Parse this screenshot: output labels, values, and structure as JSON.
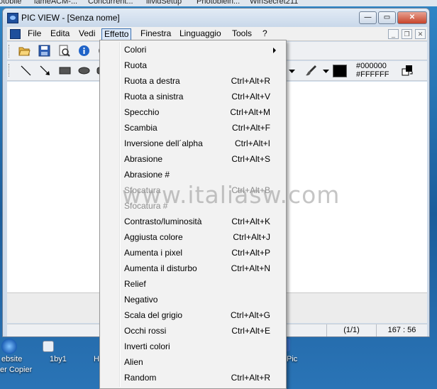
{
  "taskbar": {
    "items": [
      "otobile",
      "lameACM-...",
      "Concurrent...",
      "llivldSetup",
      "Photoblein...",
      "WinSecret211"
    ]
  },
  "desktop": {
    "icons": [
      {
        "label": "ebsite"
      },
      {
        "label": "er Copier"
      },
      {
        "label": "1by1"
      },
      {
        "label": "H"
      },
      {
        "label": "Pic"
      }
    ]
  },
  "window": {
    "title": "PIC VIEW  - [Senza nome]",
    "controls": {
      "minimize": "—",
      "maximize": "▭",
      "close": "✕"
    }
  },
  "menubar": {
    "items": [
      {
        "label": "File"
      },
      {
        "label": "Edita"
      },
      {
        "label": "Vedi"
      },
      {
        "label": "Effetto"
      },
      {
        "label": "Finestra"
      },
      {
        "label": "Linguaggio"
      },
      {
        "label": "Tools"
      },
      {
        "label": "?"
      }
    ],
    "mdi": {
      "min": "_",
      "restore": "❐",
      "close": "✕"
    }
  },
  "toolbar2": {
    "fg_hex": "#000000",
    "bg_hex": "#FFFFFF",
    "fg_color": "#000000"
  },
  "statusbar": {
    "page": "(1/1)",
    "coords": "167 : 56"
  },
  "dropdown": {
    "items": [
      {
        "label": "Colori",
        "shortcut": "",
        "submenu": true,
        "enabled": true
      },
      {
        "label": "Ruota",
        "shortcut": "",
        "submenu": false,
        "enabled": true
      },
      {
        "label": "Ruota a destra",
        "shortcut": "Ctrl+Alt+R",
        "submenu": false,
        "enabled": true
      },
      {
        "label": "Ruota a sinistra",
        "shortcut": "Ctrl+Alt+V",
        "submenu": false,
        "enabled": true
      },
      {
        "label": "Specchio",
        "shortcut": "Ctrl+Alt+M",
        "submenu": false,
        "enabled": true
      },
      {
        "label": "Scambia",
        "shortcut": "Ctrl+Alt+F",
        "submenu": false,
        "enabled": true
      },
      {
        "label": "Inversione dell´alpha",
        "shortcut": "Ctrl+Alt+I",
        "submenu": false,
        "enabled": true
      },
      {
        "label": "Abrasione",
        "shortcut": "Ctrl+Alt+S",
        "submenu": false,
        "enabled": true
      },
      {
        "label": "Abrasione #",
        "shortcut": "",
        "submenu": false,
        "enabled": true
      },
      {
        "label": "Sfocatura",
        "shortcut": "Ctrl+Alt+B",
        "submenu": false,
        "enabled": false
      },
      {
        "label": "Sfocatura #",
        "shortcut": "",
        "submenu": false,
        "enabled": false
      },
      {
        "label": "Contrasto/luminosità",
        "shortcut": "Ctrl+Alt+K",
        "submenu": false,
        "enabled": true
      },
      {
        "label": "Aggiusta colore",
        "shortcut": "Ctrl+Alt+J",
        "submenu": false,
        "enabled": true
      },
      {
        "label": "Aumenta i pixel",
        "shortcut": "Ctrl+Alt+P",
        "submenu": false,
        "enabled": true
      },
      {
        "label": "Aumenta il disturbo",
        "shortcut": "Ctrl+Alt+N",
        "submenu": false,
        "enabled": true
      },
      {
        "label": "Relief",
        "shortcut": "",
        "submenu": false,
        "enabled": true
      },
      {
        "label": "Negativo",
        "shortcut": "",
        "submenu": false,
        "enabled": true
      },
      {
        "label": "Scala del grigio",
        "shortcut": "Ctrl+Alt+G",
        "submenu": false,
        "enabled": true
      },
      {
        "label": "Occhi rossi",
        "shortcut": "Ctrl+Alt+E",
        "submenu": false,
        "enabled": true
      },
      {
        "label": "Inverti colori",
        "shortcut": "",
        "submenu": false,
        "enabled": true
      },
      {
        "label": "Alien",
        "shortcut": "",
        "submenu": false,
        "enabled": true
      },
      {
        "label": "Random",
        "shortcut": "Ctrl+Alt+R",
        "submenu": false,
        "enabled": true
      }
    ]
  },
  "watermark": "www.italiasw.com"
}
